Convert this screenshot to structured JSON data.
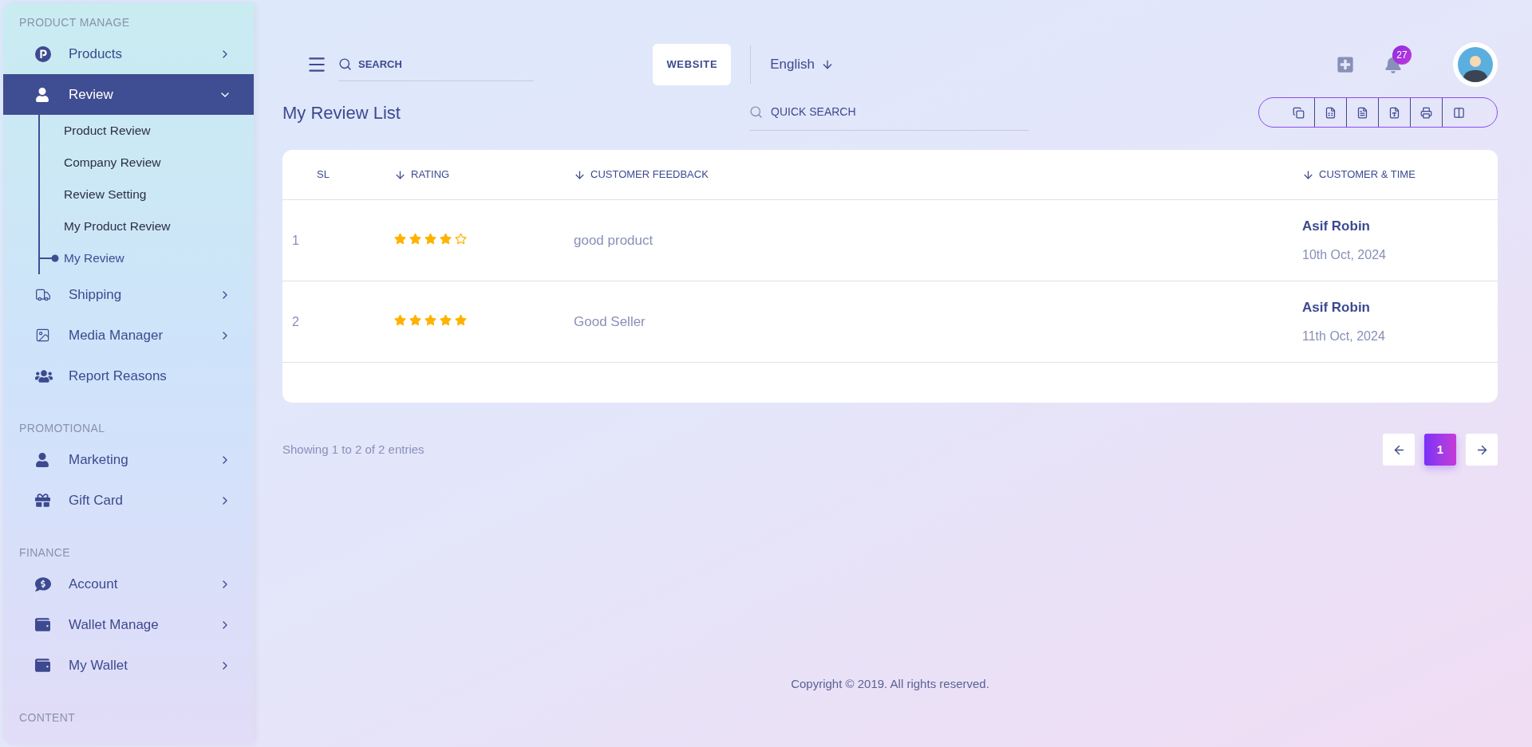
{
  "sidebar": {
    "sections": [
      {
        "heading": "PRODUCT MANAGE",
        "items": [
          {
            "label": "Products",
            "expanded": false,
            "selected": false
          },
          {
            "label": "Review",
            "expanded": true,
            "selected": true,
            "children": [
              {
                "label": "Product Review",
                "selected": false
              },
              {
                "label": "Company Review",
                "selected": false
              },
              {
                "label": "Review Setting",
                "selected": false
              },
              {
                "label": "My Product Review",
                "selected": false
              },
              {
                "label": "My Review",
                "selected": true
              }
            ]
          },
          {
            "label": "Shipping",
            "expanded": false,
            "selected": false
          },
          {
            "label": "Media Manager",
            "expanded": false,
            "selected": false
          },
          {
            "label": "Report Reasons",
            "selected": false
          }
        ]
      },
      {
        "heading": "PROMOTIONAL",
        "items": [
          {
            "label": "Marketing",
            "expanded": false,
            "selected": false
          },
          {
            "label": "Gift Card",
            "expanded": false,
            "selected": false
          }
        ]
      },
      {
        "heading": "FINANCE",
        "items": [
          {
            "label": "Account",
            "expanded": false,
            "selected": false
          },
          {
            "label": "Wallet Manage",
            "expanded": false,
            "selected": false
          },
          {
            "label": "My Wallet",
            "expanded": false,
            "selected": false
          }
        ]
      },
      {
        "heading": "CONTENT"
      }
    ]
  },
  "header": {
    "search": {
      "placeholder": "SEARCH"
    },
    "website_button": "WEBSITE",
    "language": "English",
    "notification_count": "27"
  },
  "page_title": "My Review List",
  "quick_search": {
    "placeholder": "QUICK SEARCH"
  },
  "table": {
    "columns": [
      {
        "label": "SL",
        "sortable": false
      },
      {
        "label": "RATING",
        "sortable": true
      },
      {
        "label": "CUSTOMER FEEDBACK",
        "sortable": true
      },
      {
        "label": "CUSTOMER & TIME",
        "sortable": true
      }
    ],
    "rows": [
      {
        "sl": "1",
        "stars": 4,
        "feedback": "good product",
        "customer": "Asif Robin",
        "time": "10th Oct, 2024"
      },
      {
        "sl": "2",
        "stars": 5,
        "feedback": "Good Seller",
        "customer": "Asif Robin",
        "time": "11th Oct, 2024"
      }
    ]
  },
  "entries_info": "Showing 1 to 2 of 2 entries",
  "pagination": {
    "pages": [
      {
        "label": "1",
        "selected": true
      }
    ]
  },
  "footer": "Copyright © 2019. All rights reserved."
}
